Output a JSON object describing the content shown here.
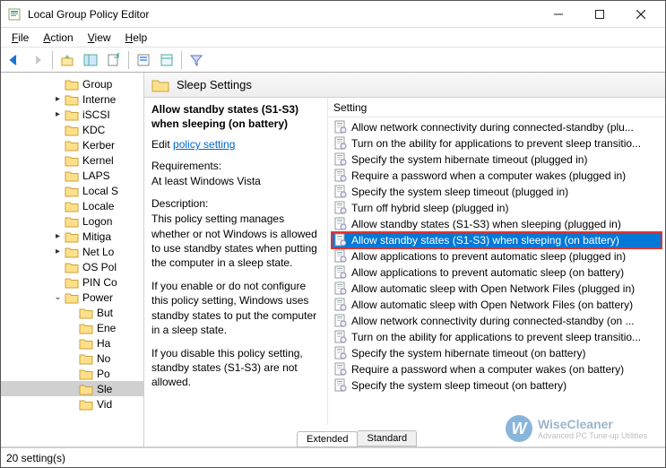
{
  "window": {
    "title": "Local Group Policy Editor"
  },
  "menus": [
    {
      "label": "File",
      "accel": "F"
    },
    {
      "label": "Action",
      "accel": "A"
    },
    {
      "label": "View",
      "accel": "V"
    },
    {
      "label": "Help",
      "accel": "H"
    }
  ],
  "tree": {
    "items": [
      {
        "label": "Group",
        "expander": ""
      },
      {
        "label": "Interne",
        "expander": "▸"
      },
      {
        "label": "iSCSI",
        "expander": "▸"
      },
      {
        "label": "KDC",
        "expander": ""
      },
      {
        "label": "Kerber",
        "expander": ""
      },
      {
        "label": "Kernel",
        "expander": ""
      },
      {
        "label": "LAPS",
        "expander": ""
      },
      {
        "label": "Local S",
        "expander": ""
      },
      {
        "label": "Locale",
        "expander": ""
      },
      {
        "label": "Logon",
        "expander": ""
      },
      {
        "label": "Mitiga",
        "expander": "▸"
      },
      {
        "label": "Net Lo",
        "expander": "▸"
      },
      {
        "label": "OS Pol",
        "expander": ""
      },
      {
        "label": "PIN Co",
        "expander": ""
      },
      {
        "label": "Power",
        "expander": "⌄",
        "expanded": true
      }
    ],
    "subitems": [
      {
        "label": "But"
      },
      {
        "label": "Ene"
      },
      {
        "label": "Ha"
      },
      {
        "label": "No"
      },
      {
        "label": "Po"
      },
      {
        "label": "Sle",
        "selected": true
      },
      {
        "label": "Vid"
      }
    ]
  },
  "header": {
    "caption": "Sleep Settings"
  },
  "description": {
    "title": "Allow standby states (S1-S3) when sleeping (on battery)",
    "edit_prefix": "Edit",
    "edit_link": "policy setting",
    "req_label": "Requirements:",
    "req_text": "At least Windows Vista",
    "desc_label": "Description:",
    "desc_p1": "This policy setting manages whether or not Windows is allowed to use standby states when putting the computer in a sleep state.",
    "desc_p2": "If you enable or do not configure this policy setting, Windows uses standby states to put the computer in a sleep state.",
    "desc_p3": "If you disable this policy setting, standby states (S1-S3) are not allowed."
  },
  "settings": {
    "col": "Setting",
    "rows": [
      "Allow network connectivity during connected-standby (plu...",
      "Turn on the ability for applications to prevent sleep transitio...",
      "Specify the system hibernate timeout (plugged in)",
      "Require a password when a computer wakes (plugged in)",
      "Specify the system sleep timeout (plugged in)",
      "Turn off hybrid sleep (plugged in)",
      "Allow standby states (S1-S3) when sleeping (plugged in)",
      "Allow standby states (S1-S3) when sleeping (on battery)",
      "Allow applications to prevent automatic sleep (plugged in)",
      "Allow applications to prevent automatic sleep (on battery)",
      "Allow automatic sleep with Open Network Files (plugged in)",
      "Allow automatic sleep with Open Network Files (on battery)",
      "Allow network connectivity during connected-standby (on ...",
      "Turn on the ability for applications to prevent sleep transitio...",
      "Specify the system hibernate timeout (on battery)",
      "Require a password when a computer wakes (on battery)",
      "Specify the system sleep timeout (on battery)"
    ],
    "selected_index": 7
  },
  "tabs": {
    "extended": "Extended",
    "standard": "Standard"
  },
  "status": "20 setting(s)",
  "watermark": {
    "name": "WiseCleaner",
    "tag": "Advanced PC Tune-up Utilities"
  }
}
